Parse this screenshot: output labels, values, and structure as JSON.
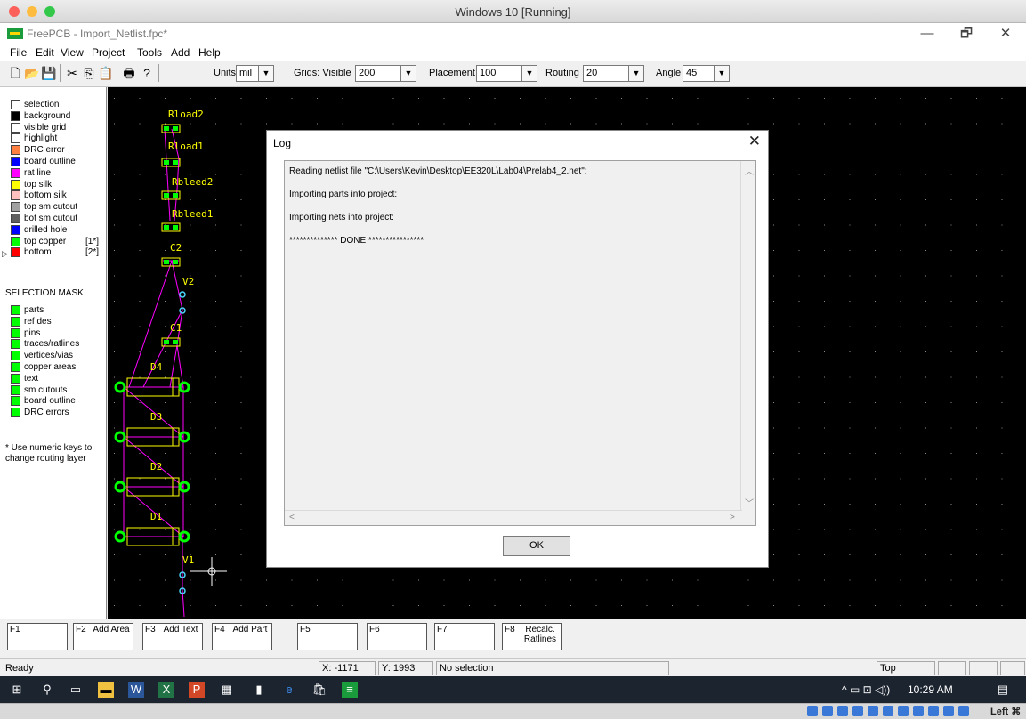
{
  "vm": {
    "title": "Windows 10 [Running]",
    "lights": [
      "#fc605b",
      "#fdbc40",
      "#34c84a"
    ]
  },
  "app": {
    "title": "FreePCB - Import_Netlist.fpc*",
    "controls": {
      "minimize": "—",
      "maximize": "🗗",
      "close": "✕"
    }
  },
  "menu": [
    "File",
    "Edit",
    "View",
    "Project",
    "Tools",
    "Add",
    "Help"
  ],
  "toolbar": {
    "icons": [
      "new-file-icon",
      "open-folder-icon",
      "save-icon",
      "cut-icon",
      "copy-icon",
      "paste-icon",
      "print-icon",
      "help-icon"
    ],
    "units_label": "Units",
    "units_value": "mil",
    "grids_label": "Grids: Visible",
    "grids_value": "200",
    "placement_label": "Placement",
    "placement_value": "100",
    "routing_label": "Routing",
    "routing_value": "20",
    "angle_label": "Angle",
    "angle_value": "45"
  },
  "layers": [
    {
      "label": "selection",
      "color": "#ffffff"
    },
    {
      "label": "background",
      "color": "#000000"
    },
    {
      "label": "visible grid",
      "color": "#ffffff"
    },
    {
      "label": "highlight",
      "color": "#ffffff"
    },
    {
      "label": "DRC error",
      "color": "#ff8040"
    },
    {
      "label": "board outline",
      "color": "#0000ff"
    },
    {
      "label": "rat line",
      "color": "#ff00ff"
    },
    {
      "label": "top silk",
      "color": "#ffff00"
    },
    {
      "label": "bottom silk",
      "color": "#ffc0c0"
    },
    {
      "label": "top sm cutout",
      "color": "#a0a0a0"
    },
    {
      "label": "bot sm cutout",
      "color": "#5f5f5f"
    },
    {
      "label": "drilled hole",
      "color": "#0000ff"
    },
    {
      "label": "top copper",
      "color": "#00ff00",
      "num": "[1*]"
    },
    {
      "label": "bottom",
      "color": "#ff0000",
      "num": "[2*]"
    }
  ],
  "selection_mask": {
    "title": "SELECTION MASK",
    "items": [
      "parts",
      "ref des",
      "pins",
      "traces/ratlines",
      "vertices/vias",
      "copper areas",
      "text",
      "sm cutouts",
      "board outline",
      "DRC errors"
    ],
    "color": "#00ff00"
  },
  "note": "* Use numeric keys to change routing layer",
  "canvas": {
    "parts": [
      "Rload2",
      "Rload1",
      "Rbleed2",
      "Rbleed1",
      "C2",
      "V2",
      "C1",
      "D4",
      "D3",
      "D2",
      "D1",
      "V1"
    ],
    "silk_color": "#ffff00",
    "copper_color": "#00ff00",
    "ratline_color": "#ff00ff"
  },
  "log": {
    "title": "Log",
    "lines": [
      "Reading netlist file \"C:\\Users\\Kevin\\Desktop\\EE320L\\Lab04\\Prelab4_2.net\":",
      "Importing parts into project:",
      "Importing nets into project:",
      "************** DONE ****************"
    ],
    "ok_label": "OK"
  },
  "fkeys": [
    {
      "num": "F1",
      "label": ""
    },
    {
      "num": "F2",
      "label": "Add Area"
    },
    {
      "num": "F3",
      "label": "Add Text"
    },
    {
      "num": "F4",
      "label": "Add Part"
    },
    {
      "num": "F5",
      "label": ""
    },
    {
      "num": "F6",
      "label": ""
    },
    {
      "num": "F7",
      "label": ""
    },
    {
      "num": "F8",
      "label": "Recalc. Ratlines"
    }
  ],
  "status": {
    "message": "Ready",
    "x": "X: -1171",
    "y": "Y: 1993",
    "selection": "No selection",
    "layer": "Top"
  },
  "taskbar": {
    "time": "10:29 AM",
    "icons": [
      "windows-start-icon",
      "search-icon",
      "task-view-icon",
      "file-explorer-icon",
      "word-icon",
      "excel-icon",
      "powerpoint-icon",
      "calculator-icon",
      "notes-icon",
      "edge-icon",
      "store-icon",
      "freepcb-icon"
    ]
  },
  "host": {
    "right_label": "Left ⌘"
  }
}
